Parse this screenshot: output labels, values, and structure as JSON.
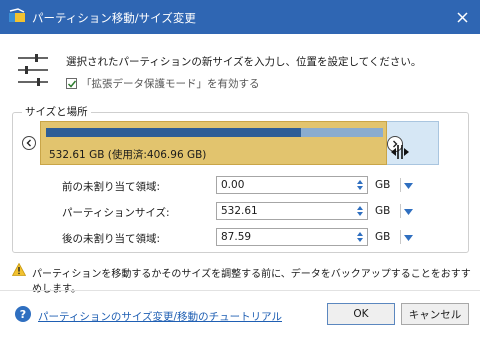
{
  "window": {
    "title": "パーティション移動/サイズ変更",
    "accent_color": "#2f66b3",
    "icon": "partition-app-icon"
  },
  "header": {
    "instruction": "選択されたパーティションの新サイズを入力し、位置を設定してください。",
    "enhanced_mode_label": "「拡張データ保護モード」を有効する",
    "enhanced_mode_checked": true
  },
  "size_location": {
    "group_label": "サイズと場所",
    "partition_label": "532.61 GB (使用済:406.96 GB)",
    "partition_color": "#e2c46e",
    "used_color": "#2d5d96",
    "unallocated_color": "#d6e7f5"
  },
  "fields": [
    {
      "label": "前の未割り当て領域:",
      "value": "0.00",
      "unit": "GB"
    },
    {
      "label": "パーティションサイズ:",
      "value": "532.61",
      "unit": "GB"
    },
    {
      "label": "後の未割り当て領域:",
      "value": "87.59",
      "unit": "GB"
    }
  ],
  "warning": {
    "text": "パーティションを移動するかそのサイズを調整する前に、データをバックアップすることをおすすめします。",
    "icon": "warning-icon"
  },
  "footer": {
    "help_link": "パーティションのサイズ変更/移動のチュートリアル",
    "ok_label": "OK",
    "cancel_label": "キャンセル"
  }
}
